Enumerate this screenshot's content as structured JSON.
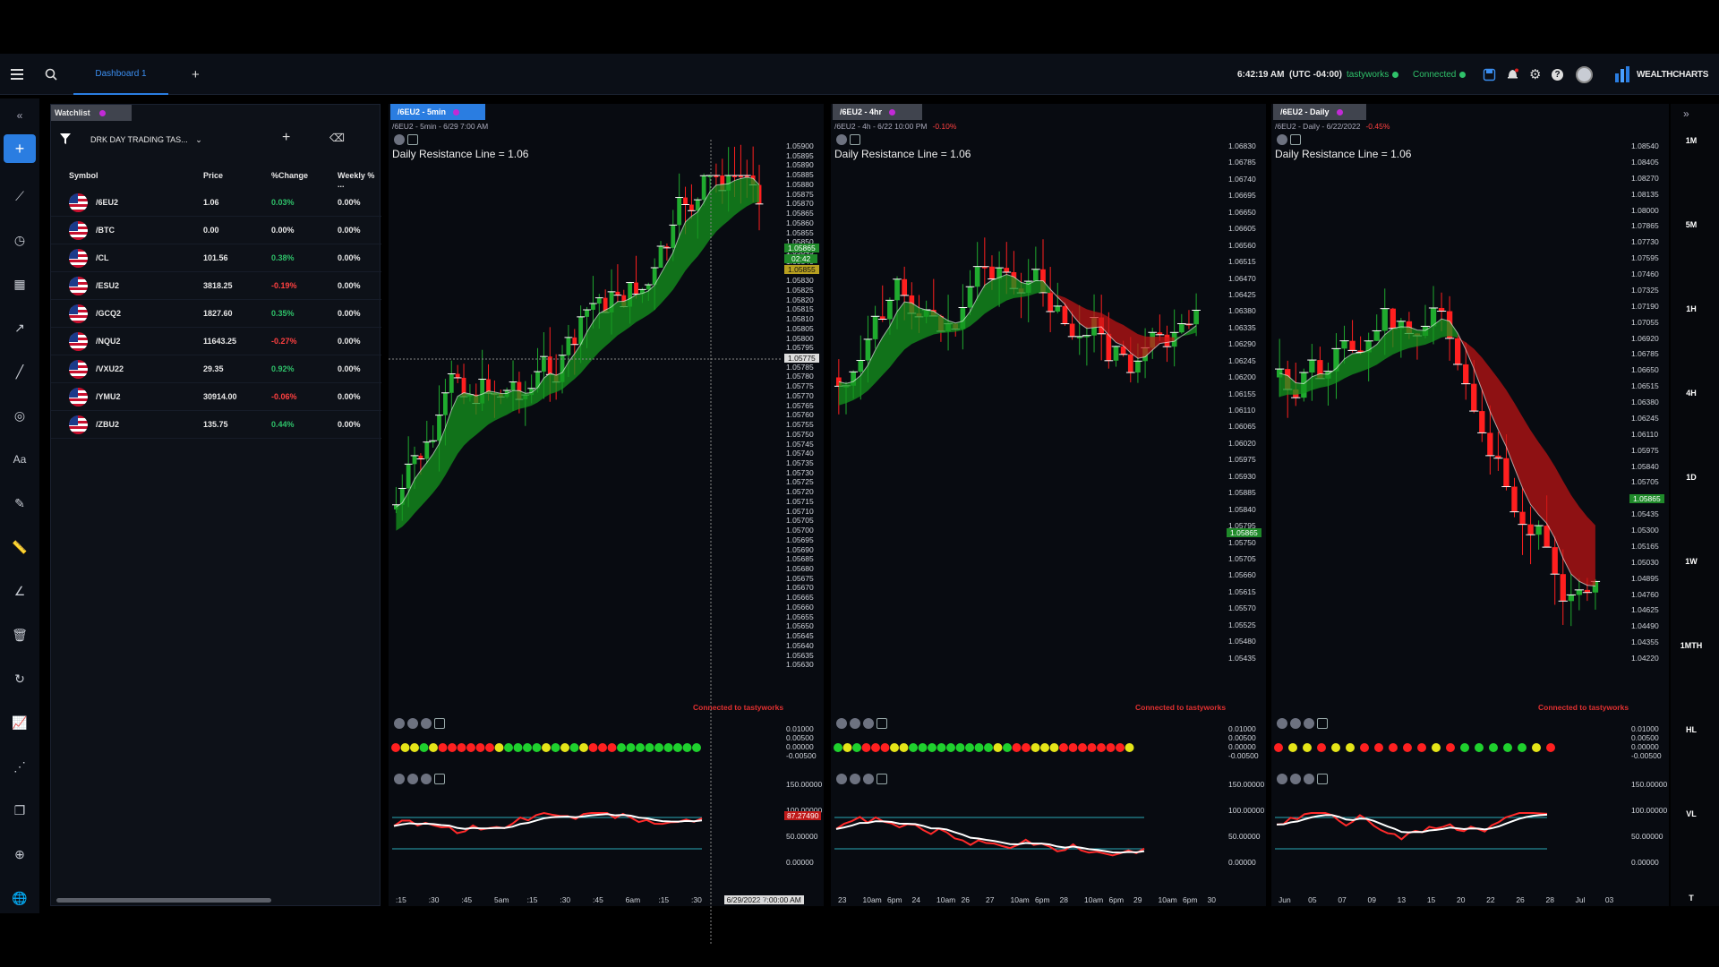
{
  "topbar": {
    "dashboard_tab": "Dashboard 1",
    "add_tab": "+",
    "time": "6:42:19 AM",
    "timezone": "(UTC -04:00)",
    "broker": "tastyworks",
    "connection": "Connected",
    "brand": "WEALTHCHARTS"
  },
  "watchlist": {
    "tab": "Watchlist",
    "filter_name": "DRK DAY TRADING TAS...",
    "columns": [
      "Symbol",
      "Price",
      "%Change",
      "Weekly % ..."
    ],
    "rows": [
      {
        "symbol": "/6EU2",
        "price": "1.06",
        "change": "0.03%",
        "weekly": "0.00%",
        "dir": "up"
      },
      {
        "symbol": "/BTC",
        "price": "0.00",
        "change": "0.00%",
        "weekly": "0.00%",
        "dir": "flat"
      },
      {
        "symbol": "/CL",
        "price": "101.56",
        "change": "0.38%",
        "weekly": "0.00%",
        "dir": "up"
      },
      {
        "symbol": "/ESU2",
        "price": "3818.25",
        "change": "-0.19%",
        "weekly": "0.00%",
        "dir": "down"
      },
      {
        "symbol": "/GCQ2",
        "price": "1827.60",
        "change": "0.35%",
        "weekly": "0.00%",
        "dir": "up"
      },
      {
        "symbol": "/NQU2",
        "price": "11643.25",
        "change": "-0.27%",
        "weekly": "0.00%",
        "dir": "down"
      },
      {
        "symbol": "/VXU22",
        "price": "29.35",
        "change": "0.92%",
        "weekly": "0.00%",
        "dir": "up"
      },
      {
        "symbol": "/YMU2",
        "price": "30914.00",
        "change": "-0.06%",
        "weekly": "0.00%",
        "dir": "down"
      },
      {
        "symbol": "/ZBU2",
        "price": "135.75",
        "change": "0.44%",
        "weekly": "0.00%",
        "dir": "up"
      }
    ]
  },
  "charts": [
    {
      "tab": "/6EU2 - 5min",
      "subtitle": "/6EU2 - 5min - 6/29 7:00 AM",
      "subtitle_change": "",
      "annotation": "Daily Resistance Line = 1.06",
      "connected": "Connected to tastyworks",
      "y_ticks": [
        "1.05900",
        "1.05895",
        "1.05890",
        "1.05885",
        "1.05880",
        "1.05875",
        "1.05870",
        "1.05865",
        "1.05860",
        "1.05855",
        "1.05850",
        "1.05845",
        "1.05840",
        "1.05835",
        "1.05830",
        "1.05825",
        "1.05820",
        "1.05815",
        "1.05810",
        "1.05805",
        "1.05800",
        "1.05795",
        "1.05790",
        "1.05785",
        "1.05780",
        "1.05775",
        "1.05770",
        "1.05765",
        "1.05760",
        "1.05755",
        "1.05750",
        "1.05745",
        "1.05740",
        "1.05735",
        "1.05730",
        "1.05725",
        "1.05720",
        "1.05715",
        "1.05710",
        "1.05705",
        "1.05700",
        "1.05695",
        "1.05690",
        "1.05685",
        "1.05680",
        "1.05675",
        "1.05670",
        "1.05665",
        "1.05660",
        "1.05655",
        "1.05650",
        "1.05645",
        "1.05640",
        "1.05635",
        "1.05630"
      ],
      "price_labels": {
        "last": "1.05865",
        "countdown": "02:42",
        "other": "1.05855",
        "crosshair": "1.05775"
      },
      "x_ticks": [
        ":15",
        ":30",
        ":45",
        "5am",
        ":15",
        ":30",
        ":45",
        "6am",
        ":15",
        ":30",
        "6/29/2022 7:00:00 AM",
        ":30"
      ],
      "osc_ticks": [
        "0.01000",
        "0.00500",
        "0.00000",
        "-0.00500"
      ],
      "stoch_ticks": [
        "150.00000",
        "100.00000",
        "50.00000",
        "0.00000"
      ],
      "stoch_label": "87.27490",
      "dots": [
        "r",
        "y",
        "y",
        "g",
        "y",
        "r",
        "r",
        "r",
        "r",
        "r",
        "r",
        "y",
        "g",
        "g",
        "g",
        "g",
        "y",
        "g",
        "y",
        "g",
        "y",
        "r",
        "r",
        "r",
        "g",
        "g",
        "g",
        "g",
        "g",
        "g",
        "g",
        "g",
        "g"
      ]
    },
    {
      "tab": "/6EU2 - 4hr",
      "subtitle": "/6EU2 - 4h - 6/22 10:00 PM",
      "subtitle_change": "-0.10%",
      "annotation": "Daily Resistance Line = 1.06",
      "connected": "Connected to tastyworks",
      "y_ticks": [
        "1.06830",
        "1.06785",
        "1.06740",
        "1.06695",
        "1.06650",
        "1.06605",
        "1.06560",
        "1.06515",
        "1.06470",
        "1.06425",
        "1.06380",
        "1.06335",
        "1.06290",
        "1.06245",
        "1.06200",
        "1.06155",
        "1.06110",
        "1.06065",
        "1.06020",
        "1.05975",
        "1.05930",
        "1.05885",
        "1.05840",
        "1.05795",
        "1.05750",
        "1.05705",
        "1.05660",
        "1.05615",
        "1.05570",
        "1.05525",
        "1.05480",
        "1.05435"
      ],
      "price_labels": {
        "last": "1.05865"
      },
      "x_ticks": [
        "23",
        "10am",
        "6pm",
        "24",
        "10am",
        "26",
        "27",
        "10am",
        "6pm",
        "28",
        "10am",
        "6pm",
        "29",
        "10am",
        "6pm",
        "30"
      ],
      "osc_ticks": [
        "0.01000",
        "0.00500",
        "0.00000",
        "-0.00500"
      ],
      "stoch_ticks": [
        "150.00000",
        "100.00000",
        "50.00000",
        "0.00000"
      ],
      "dots": [
        "g",
        "y",
        "g",
        "r",
        "r",
        "r",
        "y",
        "y",
        "g",
        "g",
        "g",
        "g",
        "g",
        "g",
        "g",
        "g",
        "g",
        "y",
        "g",
        "r",
        "r",
        "y",
        "y",
        "y",
        "r",
        "r",
        "r",
        "r",
        "r",
        "r",
        "r",
        "y"
      ]
    },
    {
      "tab": "/6EU2 - Daily",
      "subtitle": "/6EU2 - Daily - 6/22/2022",
      "subtitle_change": "-0.45%",
      "annotation": "Daily Resistance Line = 1.06",
      "connected": "Connected to tastyworks",
      "y_ticks": [
        "1.08540",
        "1.08405",
        "1.08270",
        "1.08135",
        "1.08000",
        "1.07865",
        "1.07730",
        "1.07595",
        "1.07460",
        "1.07325",
        "1.07190",
        "1.07055",
        "1.06920",
        "1.06785",
        "1.06650",
        "1.06515",
        "1.06380",
        "1.06245",
        "1.06110",
        "1.05975",
        "1.05840",
        "1.05705",
        "1.05570",
        "1.05435",
        "1.05300",
        "1.05165",
        "1.05030",
        "1.04895",
        "1.04760",
        "1.04625",
        "1.04490",
        "1.04355",
        "1.04220"
      ],
      "price_labels": {
        "last": "1.05865"
      },
      "x_ticks": [
        "Jun",
        "05",
        "07",
        "09",
        "13",
        "15",
        "20",
        "22",
        "26",
        "28",
        "Jul",
        "03"
      ],
      "osc_ticks": [
        "0.01000",
        "0.00500",
        "0.00000",
        "-0.00500"
      ],
      "stoch_ticks": [
        "150.00000",
        "100.00000",
        "50.00000",
        "0.00000"
      ],
      "dots": [
        "r",
        "y",
        "y",
        "r",
        "y",
        "y",
        "r",
        "r",
        "r",
        "r",
        "r",
        "y",
        "r",
        "g",
        "g",
        "g",
        "g",
        "g",
        "y",
        "r"
      ]
    }
  ],
  "timeframes": [
    "1M",
    "5M",
    "1H",
    "4H",
    "1D",
    "1W",
    "1MTH",
    "HL",
    "VL",
    "T"
  ],
  "colors": {
    "up": "#1faa2e",
    "down": "#ff1f1f",
    "accent": "#2a7de1",
    "yellow": "#e5e518"
  }
}
